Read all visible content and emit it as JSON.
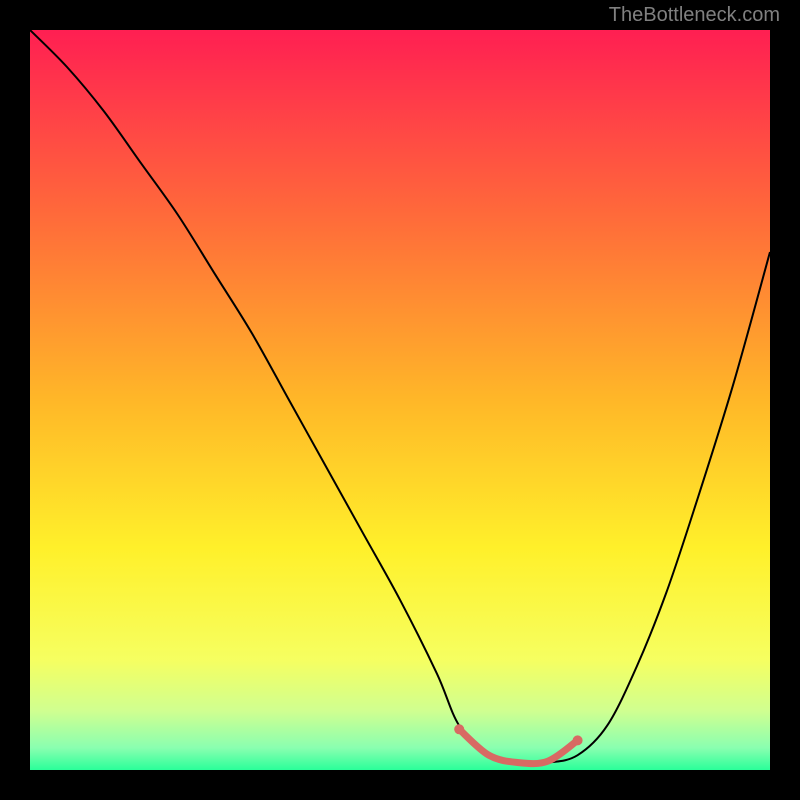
{
  "watermark": "TheBottleneck.com",
  "chart_data": {
    "type": "line",
    "title": "",
    "xlabel": "",
    "ylabel": "",
    "xlim": [
      0,
      100
    ],
    "ylim": [
      0,
      100
    ],
    "background_gradient": {
      "type": "vertical",
      "stops": [
        {
          "pos": 0.0,
          "color": "#ff1f52"
        },
        {
          "pos": 0.25,
          "color": "#ff6a3a"
        },
        {
          "pos": 0.5,
          "color": "#ffb728"
        },
        {
          "pos": 0.7,
          "color": "#fff02a"
        },
        {
          "pos": 0.85,
          "color": "#f6ff60"
        },
        {
          "pos": 0.92,
          "color": "#d0ff90"
        },
        {
          "pos": 0.97,
          "color": "#8affb0"
        },
        {
          "pos": 1.0,
          "color": "#2aff9a"
        }
      ]
    },
    "series": [
      {
        "name": "bottleneck-curve",
        "stroke": "#000000",
        "stroke_width": 2,
        "x": [
          0,
          5,
          10,
          15,
          20,
          25,
          30,
          35,
          40,
          45,
          50,
          55,
          58,
          62,
          66,
          70,
          74,
          78,
          82,
          86,
          90,
          95,
          100
        ],
        "y": [
          100,
          95,
          89,
          82,
          75,
          67,
          59,
          50,
          41,
          32,
          23,
          13,
          6,
          2,
          1,
          1,
          2,
          6,
          14,
          24,
          36,
          52,
          70
        ]
      }
    ],
    "highlight": {
      "name": "optimal-range",
      "stroke": "#d86a63",
      "stroke_width": 7,
      "x": [
        58,
        62,
        66,
        70,
        74
      ],
      "y": [
        5.5,
        2.0,
        1.0,
        1.2,
        4
      ]
    }
  }
}
